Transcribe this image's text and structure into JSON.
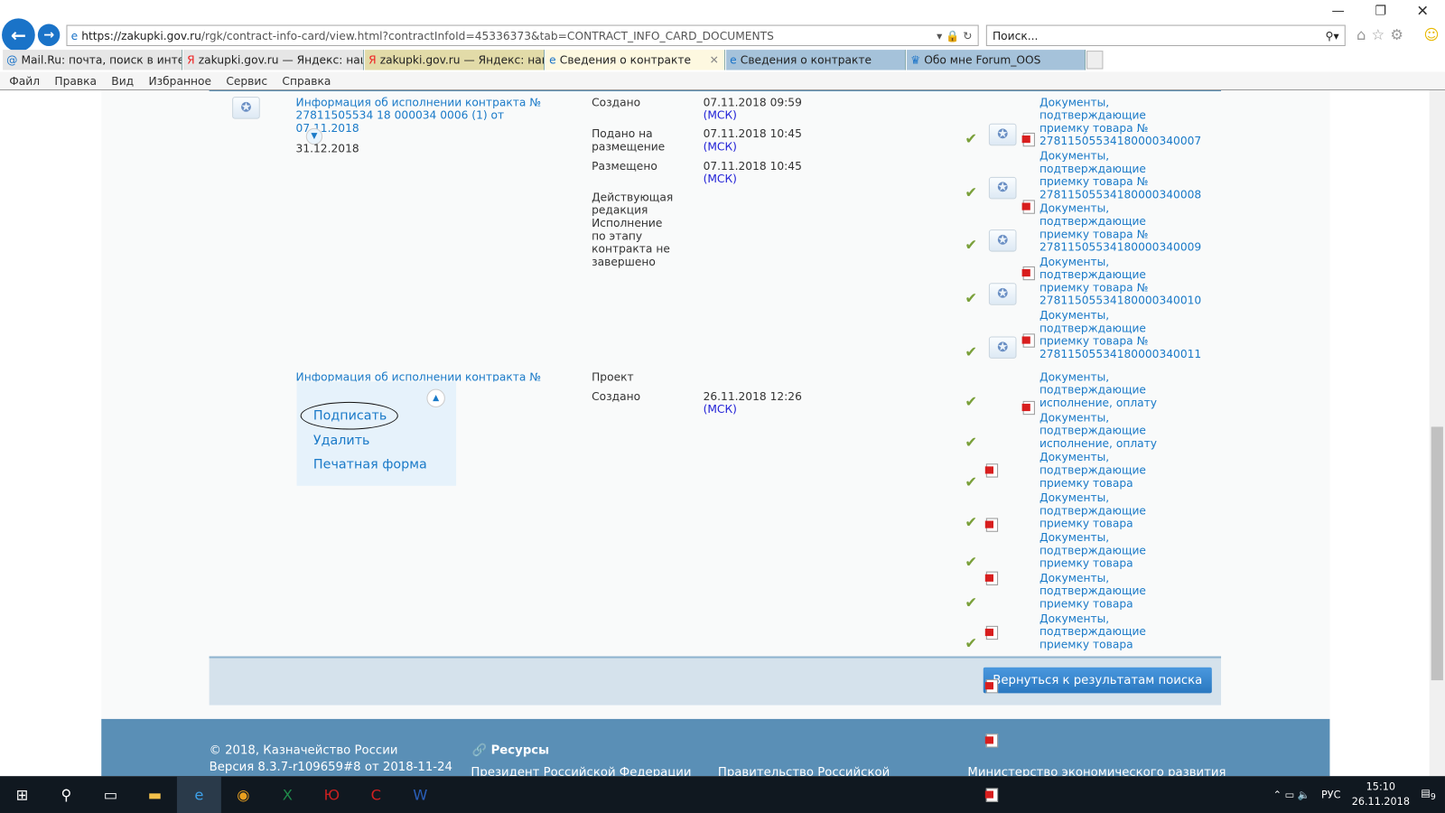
{
  "browser": {
    "url_domain": "https://zakupki.gov.ru",
    "url_path": "/rgk/contract-info-card/view.html?contractInfoId=45336373&tab=CONTRACT_INFO_CARD_DOCUMENTS",
    "search_placeholder": "Поиск...",
    "tabs": [
      {
        "label": "Mail.Ru: почта, поиск в интер...",
        "icon": "mailru-icon"
      },
      {
        "label": "zakupki.gov.ru — Яндекс: наш...",
        "icon": "yandex-icon"
      },
      {
        "label": "zakupki.gov.ru — Яндекс: наш...",
        "icon": "yandex-icon"
      },
      {
        "label": "Сведения о контракте",
        "icon": "ie-icon",
        "active": true
      },
      {
        "label": "Сведения о контракте",
        "icon": "ie-icon"
      },
      {
        "label": "Обо мне Forum_OOS",
        "icon": "emblem-icon"
      }
    ],
    "menu": [
      "Файл",
      "Правка",
      "Вид",
      "Избранное",
      "Сервис",
      "Справка"
    ]
  },
  "record1": {
    "title": "Информация об исполнении контракта № 27811505534 18 000034 0006 (1) от 07.11.2018",
    "date": "31.12.2018",
    "statuses": [
      {
        "label": "Создано",
        "value": "07.11.2018 09:59",
        "tz": "(МСК)"
      },
      {
        "label": "Подано на размещение",
        "value": "07.11.2018 10:45",
        "tz": "(МСК)"
      },
      {
        "label": "Размещено",
        "value": "07.11.2018 10:45",
        "tz": "(МСК)"
      },
      {
        "label": "Действующая редакция Исполнение по этапу контракта не завершено",
        "value": "",
        "tz": ""
      }
    ],
    "documents": [
      "Документы, подтверждающие приемку товара № 27811505534180000340007",
      "Документы, подтверждающие приемку товара № 27811505534180000340008",
      "Документы, подтверждающие приемку товара № 27811505534180000340009",
      "Документы, подтверждающие приемку товара № 27811505534180000340010",
      "Документы, подтверждающие приемку товара № 27811505534180000340011"
    ]
  },
  "record2": {
    "title": "Информация об исполнении контракта №",
    "statuses": [
      {
        "label": "Проект",
        "value": "",
        "tz": ""
      },
      {
        "label": "Создано",
        "value": "26.11.2018 12:26",
        "tz": "(МСК)"
      }
    ],
    "menu": [
      "Подписать",
      "Удалить",
      "Печатная форма"
    ],
    "documents": [
      "Документы, подтверждающие исполнение, оплату",
      "Документы, подтверждающие исполнение, оплату",
      "Документы, подтверждающие приемку товара",
      "Документы, подтверждающие приемку товара",
      "Документы, подтверждающие приемку товара",
      "Документы, подтверждающие приемку товара",
      "Документы, подтверждающие приемку товара"
    ]
  },
  "back_button": "Вернуться к результатам поиска",
  "footer": {
    "copyright": "© 2018, Казначейство России",
    "version": "Версия 8.3.7-r109659#8 от 2018-11-24",
    "resources": "Ресурсы",
    "links": [
      "Президент Российской Федерации",
      "Правительство Российской",
      "Министерство экономического развития"
    ]
  },
  "taskbar": {
    "lang": "РУС",
    "time": "15:10",
    "date": "26.11.2018",
    "notifications": "9"
  }
}
